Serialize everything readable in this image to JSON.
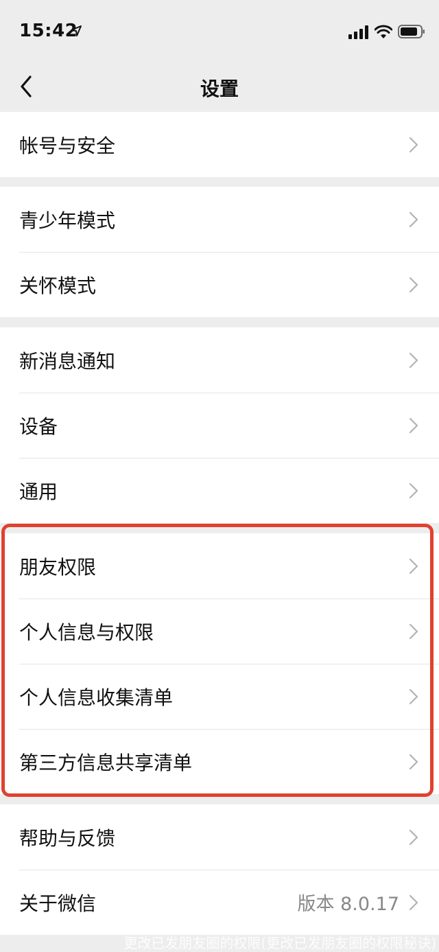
{
  "status_bar": {
    "time": "15:42"
  },
  "nav": {
    "title": "设置"
  },
  "groups": [
    {
      "items": [
        {
          "label": "帐号与安全"
        }
      ]
    },
    {
      "items": [
        {
          "label": "青少年模式"
        },
        {
          "label": "关怀模式"
        }
      ]
    },
    {
      "items": [
        {
          "label": "新消息通知"
        },
        {
          "label": "设备"
        },
        {
          "label": "通用"
        }
      ]
    },
    {
      "items": [
        {
          "label": "朋友权限"
        },
        {
          "label": "个人信息与权限"
        },
        {
          "label": "个人信息收集清单"
        },
        {
          "label": "第三方信息共享清单"
        }
      ]
    },
    {
      "items": [
        {
          "label": "帮助与反馈"
        },
        {
          "label": "关于微信",
          "value": "版本 8.0.17"
        }
      ]
    }
  ],
  "highlight_color": "#e0412f",
  "watermark": "更改已发朋友圈的权限(更改已发朋友圈的权限秘诀)"
}
